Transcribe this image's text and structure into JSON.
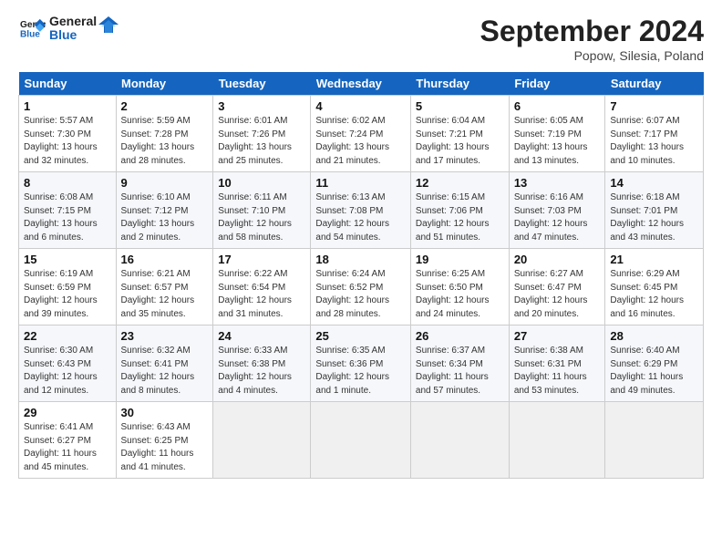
{
  "header": {
    "logo_general": "General",
    "logo_blue": "Blue",
    "month_title": "September 2024",
    "location": "Popow, Silesia, Poland"
  },
  "weekdays": [
    "Sunday",
    "Monday",
    "Tuesday",
    "Wednesday",
    "Thursday",
    "Friday",
    "Saturday"
  ],
  "weeks": [
    [
      {
        "day": "1",
        "sunrise": "Sunrise: 5:57 AM",
        "sunset": "Sunset: 7:30 PM",
        "daylight": "Daylight: 13 hours and 32 minutes."
      },
      {
        "day": "2",
        "sunrise": "Sunrise: 5:59 AM",
        "sunset": "Sunset: 7:28 PM",
        "daylight": "Daylight: 13 hours and 28 minutes."
      },
      {
        "day": "3",
        "sunrise": "Sunrise: 6:01 AM",
        "sunset": "Sunset: 7:26 PM",
        "daylight": "Daylight: 13 hours and 25 minutes."
      },
      {
        "day": "4",
        "sunrise": "Sunrise: 6:02 AM",
        "sunset": "Sunset: 7:24 PM",
        "daylight": "Daylight: 13 hours and 21 minutes."
      },
      {
        "day": "5",
        "sunrise": "Sunrise: 6:04 AM",
        "sunset": "Sunset: 7:21 PM",
        "daylight": "Daylight: 13 hours and 17 minutes."
      },
      {
        "day": "6",
        "sunrise": "Sunrise: 6:05 AM",
        "sunset": "Sunset: 7:19 PM",
        "daylight": "Daylight: 13 hours and 13 minutes."
      },
      {
        "day": "7",
        "sunrise": "Sunrise: 6:07 AM",
        "sunset": "Sunset: 7:17 PM",
        "daylight": "Daylight: 13 hours and 10 minutes."
      }
    ],
    [
      {
        "day": "8",
        "sunrise": "Sunrise: 6:08 AM",
        "sunset": "Sunset: 7:15 PM",
        "daylight": "Daylight: 13 hours and 6 minutes."
      },
      {
        "day": "9",
        "sunrise": "Sunrise: 6:10 AM",
        "sunset": "Sunset: 7:12 PM",
        "daylight": "Daylight: 13 hours and 2 minutes."
      },
      {
        "day": "10",
        "sunrise": "Sunrise: 6:11 AM",
        "sunset": "Sunset: 7:10 PM",
        "daylight": "Daylight: 12 hours and 58 minutes."
      },
      {
        "day": "11",
        "sunrise": "Sunrise: 6:13 AM",
        "sunset": "Sunset: 7:08 PM",
        "daylight": "Daylight: 12 hours and 54 minutes."
      },
      {
        "day": "12",
        "sunrise": "Sunrise: 6:15 AM",
        "sunset": "Sunset: 7:06 PM",
        "daylight": "Daylight: 12 hours and 51 minutes."
      },
      {
        "day": "13",
        "sunrise": "Sunrise: 6:16 AM",
        "sunset": "Sunset: 7:03 PM",
        "daylight": "Daylight: 12 hours and 47 minutes."
      },
      {
        "day": "14",
        "sunrise": "Sunrise: 6:18 AM",
        "sunset": "Sunset: 7:01 PM",
        "daylight": "Daylight: 12 hours and 43 minutes."
      }
    ],
    [
      {
        "day": "15",
        "sunrise": "Sunrise: 6:19 AM",
        "sunset": "Sunset: 6:59 PM",
        "daylight": "Daylight: 12 hours and 39 minutes."
      },
      {
        "day": "16",
        "sunrise": "Sunrise: 6:21 AM",
        "sunset": "Sunset: 6:57 PM",
        "daylight": "Daylight: 12 hours and 35 minutes."
      },
      {
        "day": "17",
        "sunrise": "Sunrise: 6:22 AM",
        "sunset": "Sunset: 6:54 PM",
        "daylight": "Daylight: 12 hours and 31 minutes."
      },
      {
        "day": "18",
        "sunrise": "Sunrise: 6:24 AM",
        "sunset": "Sunset: 6:52 PM",
        "daylight": "Daylight: 12 hours and 28 minutes."
      },
      {
        "day": "19",
        "sunrise": "Sunrise: 6:25 AM",
        "sunset": "Sunset: 6:50 PM",
        "daylight": "Daylight: 12 hours and 24 minutes."
      },
      {
        "day": "20",
        "sunrise": "Sunrise: 6:27 AM",
        "sunset": "Sunset: 6:47 PM",
        "daylight": "Daylight: 12 hours and 20 minutes."
      },
      {
        "day": "21",
        "sunrise": "Sunrise: 6:29 AM",
        "sunset": "Sunset: 6:45 PM",
        "daylight": "Daylight: 12 hours and 16 minutes."
      }
    ],
    [
      {
        "day": "22",
        "sunrise": "Sunrise: 6:30 AM",
        "sunset": "Sunset: 6:43 PM",
        "daylight": "Daylight: 12 hours and 12 minutes."
      },
      {
        "day": "23",
        "sunrise": "Sunrise: 6:32 AM",
        "sunset": "Sunset: 6:41 PM",
        "daylight": "Daylight: 12 hours and 8 minutes."
      },
      {
        "day": "24",
        "sunrise": "Sunrise: 6:33 AM",
        "sunset": "Sunset: 6:38 PM",
        "daylight": "Daylight: 12 hours and 4 minutes."
      },
      {
        "day": "25",
        "sunrise": "Sunrise: 6:35 AM",
        "sunset": "Sunset: 6:36 PM",
        "daylight": "Daylight: 12 hours and 1 minute."
      },
      {
        "day": "26",
        "sunrise": "Sunrise: 6:37 AM",
        "sunset": "Sunset: 6:34 PM",
        "daylight": "Daylight: 11 hours and 57 minutes."
      },
      {
        "day": "27",
        "sunrise": "Sunrise: 6:38 AM",
        "sunset": "Sunset: 6:31 PM",
        "daylight": "Daylight: 11 hours and 53 minutes."
      },
      {
        "day": "28",
        "sunrise": "Sunrise: 6:40 AM",
        "sunset": "Sunset: 6:29 PM",
        "daylight": "Daylight: 11 hours and 49 minutes."
      }
    ],
    [
      {
        "day": "29",
        "sunrise": "Sunrise: 6:41 AM",
        "sunset": "Sunset: 6:27 PM",
        "daylight": "Daylight: 11 hours and 45 minutes."
      },
      {
        "day": "30",
        "sunrise": "Sunrise: 6:43 AM",
        "sunset": "Sunset: 6:25 PM",
        "daylight": "Daylight: 11 hours and 41 minutes."
      },
      null,
      null,
      null,
      null,
      null
    ]
  ]
}
